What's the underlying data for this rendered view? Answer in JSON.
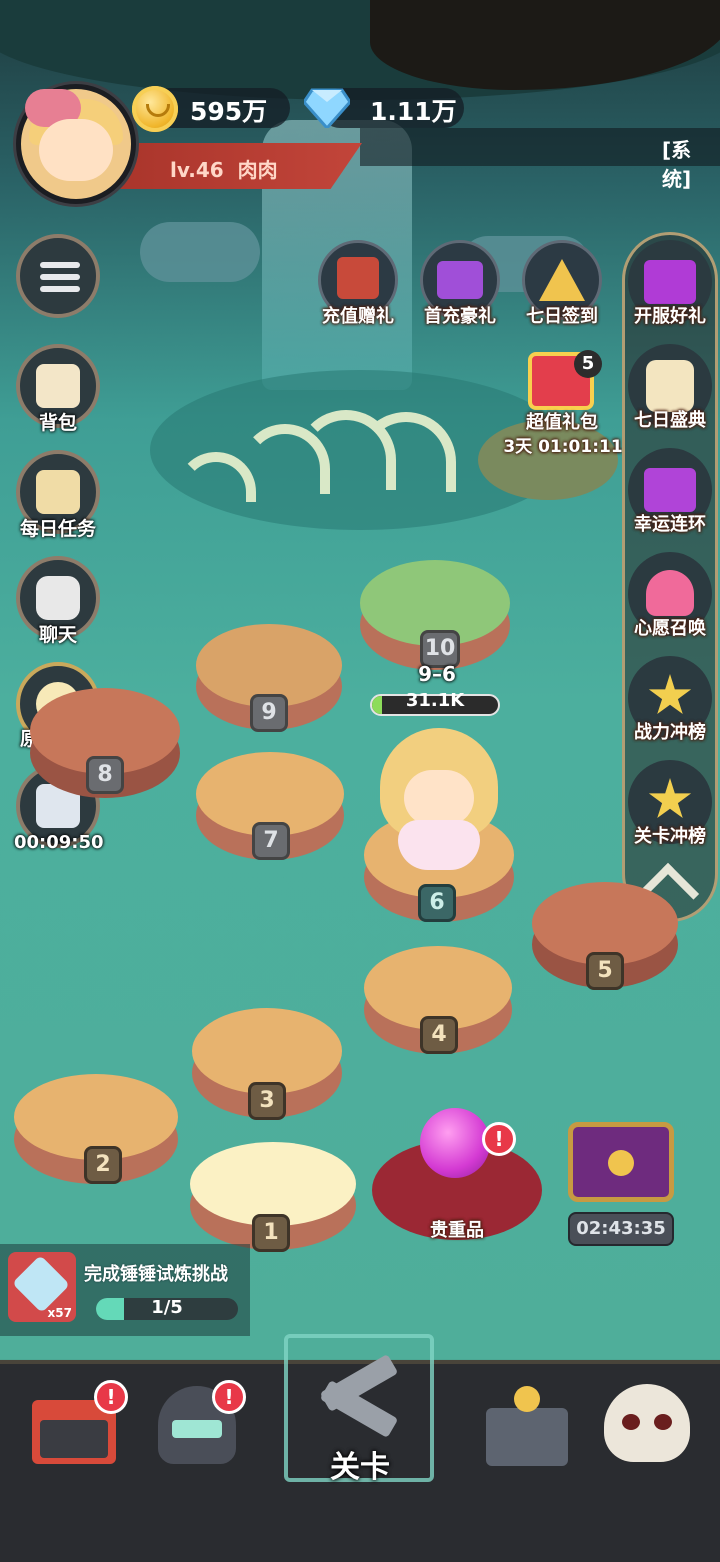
{
  "header": {
    "coins": "595万",
    "gems": "1.11万",
    "level": "lv.46",
    "player_name": "肉肉",
    "system_tab": "[系统]"
  },
  "left_menu": {
    "bag": "背包",
    "daily_tasks": "每日任务",
    "chat": "聊天",
    "awaken": "原力觉醒",
    "ad_timer": "00:09:50"
  },
  "events_top": [
    {
      "label": "充值赠礼",
      "icon": "envelope-icon"
    },
    {
      "label": "首充豪礼",
      "icon": "gift-box-icon"
    },
    {
      "label": "七日签到",
      "icon": "calendar-icon"
    }
  ],
  "super_gift": {
    "label": "超值礼包",
    "count": "5",
    "timer": "3天 01:01:11"
  },
  "right_menu": [
    {
      "label": "开服好礼",
      "icon": "gift-icon"
    },
    {
      "label": "七日盛典",
      "icon": "cake-icon"
    },
    {
      "label": "幸运连环",
      "icon": "gift-icon"
    },
    {
      "label": "心愿召唤",
      "icon": "heart-icon"
    },
    {
      "label": "战力冲榜",
      "icon": "star-icon"
    },
    {
      "label": "关卡冲榜",
      "icon": "star-icon"
    }
  ],
  "stage": {
    "current": "9–6",
    "power": "31.1K",
    "power_fill": 0.08
  },
  "islands": [
    "1",
    "2",
    "3",
    "4",
    "5",
    "6",
    "7",
    "8",
    "9",
    "10"
  ],
  "treasure": {
    "label": "贵重品",
    "badge": "!"
  },
  "chest": {
    "timer": "02:43:35"
  },
  "quest": {
    "title": "完成锤锤试炼挑战",
    "item_count": "x57",
    "progress": "1/5",
    "progress_fill": 0.2
  },
  "bottom_nav": {
    "shop_badge": "!",
    "hero_badge": "!",
    "stage_label": "关卡"
  },
  "colors": {
    "accent": "#64d9b8",
    "badge_red": "#e83848",
    "level_bar": "#c2453a"
  }
}
